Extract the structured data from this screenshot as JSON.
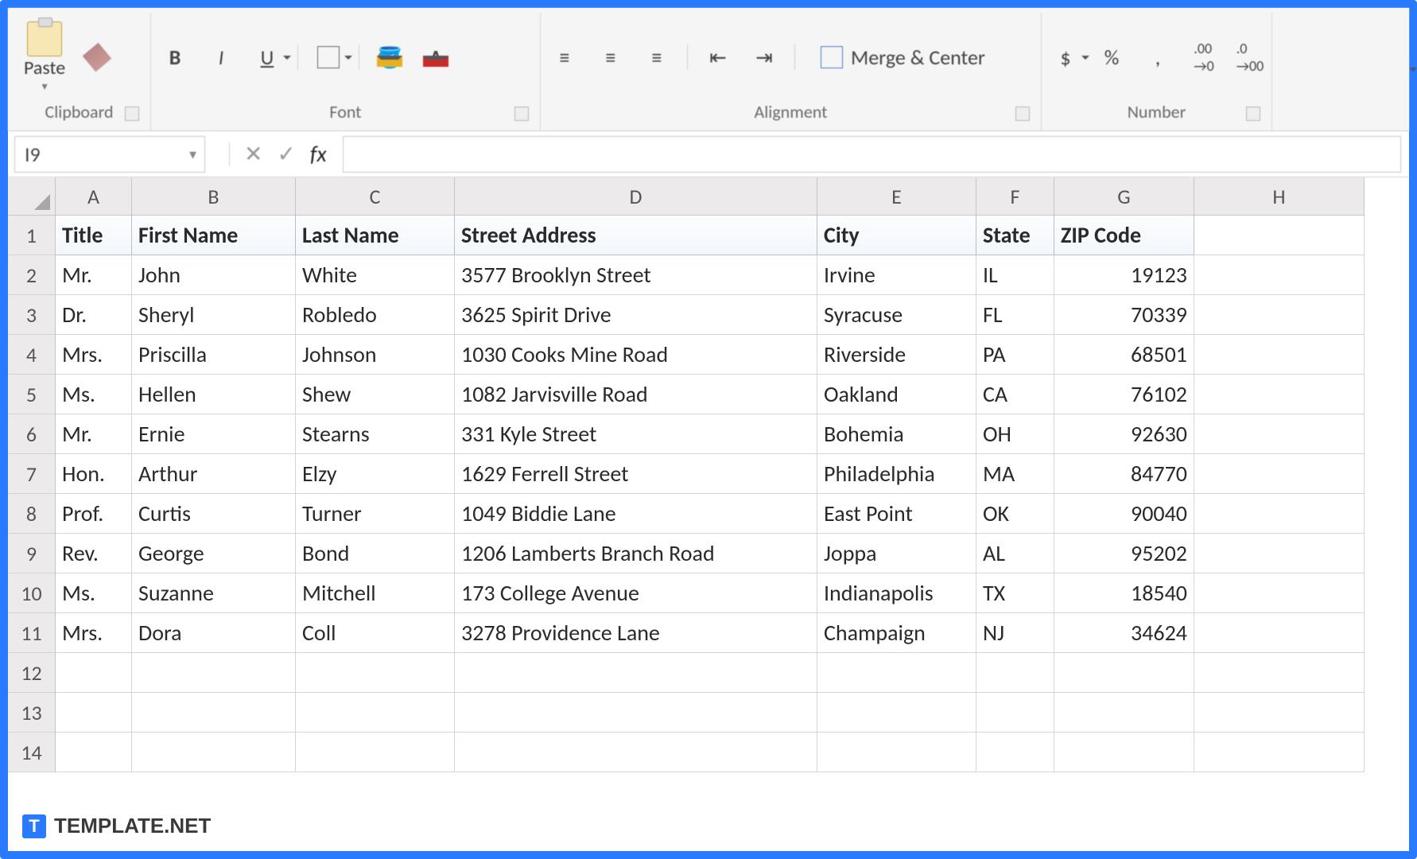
{
  "ribbon": {
    "clipboard": {
      "label": "Clipboard",
      "paste_label": "Paste"
    },
    "font": {
      "label": "Font"
    },
    "alignment": {
      "label": "Alignment",
      "merge_label": "Merge & Center"
    },
    "number": {
      "label": "Number",
      "currency": "$",
      "percent": "%",
      "comma": ","
    }
  },
  "name_box": "I9",
  "fx_label": "fx",
  "columns": [
    "A",
    "B",
    "C",
    "D",
    "E",
    "F",
    "G",
    "H"
  ],
  "headers": [
    "Title",
    "First Name",
    "Last Name",
    "Street Address",
    "City",
    "State",
    "ZIP Code"
  ],
  "rows": [
    {
      "n": 1
    },
    {
      "n": 2,
      "d": [
        "Mr.",
        "John",
        "White",
        "3577 Brooklyn Street",
        "Irvine",
        "IL",
        "19123"
      ]
    },
    {
      "n": 3,
      "d": [
        "Dr.",
        "Sheryl",
        "Robledo",
        "3625 Spirit Drive",
        "Syracuse",
        "FL",
        "70339"
      ]
    },
    {
      "n": 4,
      "d": [
        "Mrs.",
        "Priscilla",
        "Johnson",
        "1030 Cooks Mine Road",
        "Riverside",
        "PA",
        "68501"
      ]
    },
    {
      "n": 5,
      "d": [
        "Ms.",
        "Hellen",
        "Shew",
        "1082 Jarvisville Road",
        "Oakland",
        "CA",
        "76102"
      ]
    },
    {
      "n": 6,
      "d": [
        "Mr.",
        "Ernie",
        "Stearns",
        "331 Kyle Street",
        "Bohemia",
        "OH",
        "92630"
      ]
    },
    {
      "n": 7,
      "d": [
        "Hon.",
        "Arthur",
        "Elzy",
        "1629 Ferrell Street",
        "Philadelphia",
        "MA",
        "84770"
      ]
    },
    {
      "n": 8,
      "d": [
        "Prof.",
        "Curtis",
        "Turner",
        "1049 Biddie Lane",
        "East Point",
        "OK",
        "90040"
      ]
    },
    {
      "n": 9,
      "d": [
        "Rev.",
        "George",
        "Bond",
        "1206 Lamberts Branch Road",
        "Joppa",
        "AL",
        "95202"
      ]
    },
    {
      "n": 10,
      "d": [
        "Ms.",
        "Suzanne",
        "Mitchell",
        "173 College Avenue",
        "Indianapolis",
        "TX",
        "18540"
      ]
    },
    {
      "n": 11,
      "d": [
        "Mrs.",
        "Dora",
        "Coll",
        "3278 Providence Lane",
        "Champaign",
        "NJ",
        "34624"
      ]
    },
    {
      "n": 12
    },
    {
      "n": 13
    },
    {
      "n": 14
    }
  ],
  "watermark": {
    "icon": "T",
    "text": "TEMPLATE.NET"
  }
}
